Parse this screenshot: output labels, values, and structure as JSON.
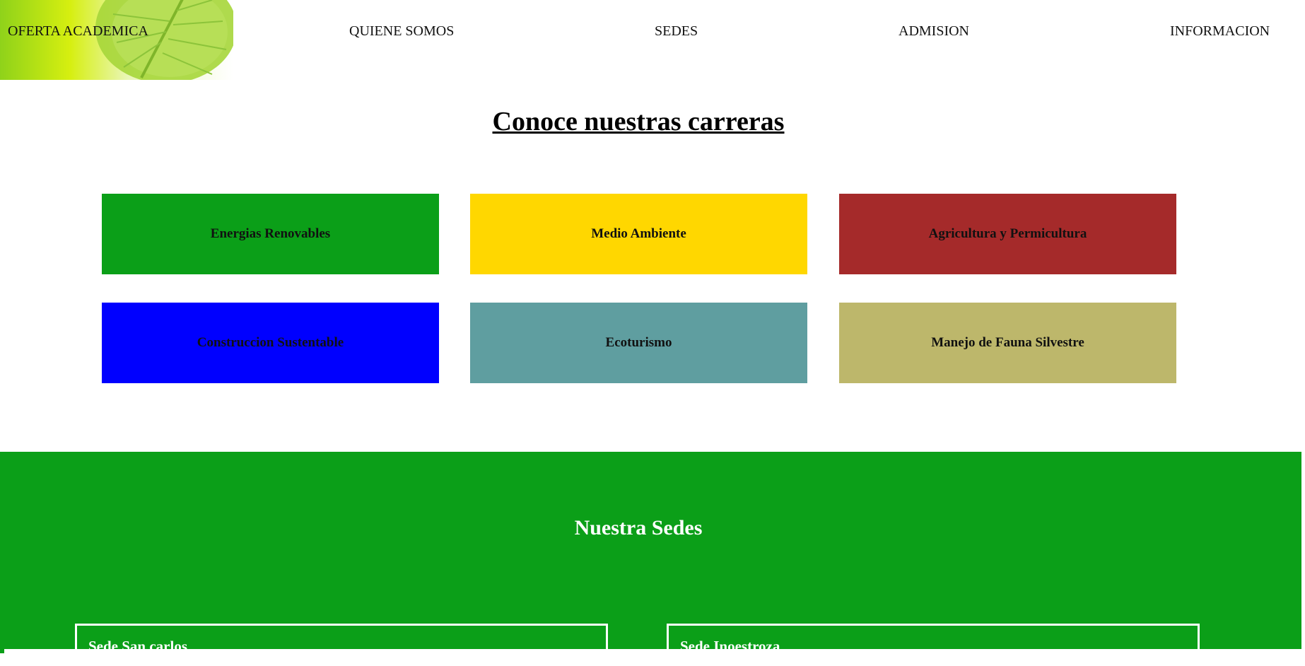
{
  "nav": {
    "items": [
      {
        "label": "OFERTA ACADEMICA"
      },
      {
        "label": "QUIENE SOMOS"
      },
      {
        "label": "SEDES"
      },
      {
        "label": "ADMISION"
      },
      {
        "label": "INFORMACION"
      }
    ]
  },
  "careers": {
    "title": "Conoce nuestras carreras",
    "cards": [
      {
        "label": "Energias Renovables",
        "color": "#0b9f18"
      },
      {
        "label": "Medio Ambiente",
        "color": "#ffd700"
      },
      {
        "label": "Agricultura y Permicultura",
        "color": "#a52a2a"
      },
      {
        "label": "Construccion Sustentable",
        "color": "#0000ff"
      },
      {
        "label": "Ecoturismo",
        "color": "#5f9ea0"
      },
      {
        "label": "Manejo de Fauna Silvestre",
        "color": "#bdb76b"
      }
    ]
  },
  "sedes": {
    "title": "Nuestra Sedes",
    "items": [
      {
        "name": "Sede San carlos"
      },
      {
        "name": "Sede Inoestroza"
      }
    ]
  },
  "colors": {
    "section_green": "#0b9f18"
  }
}
